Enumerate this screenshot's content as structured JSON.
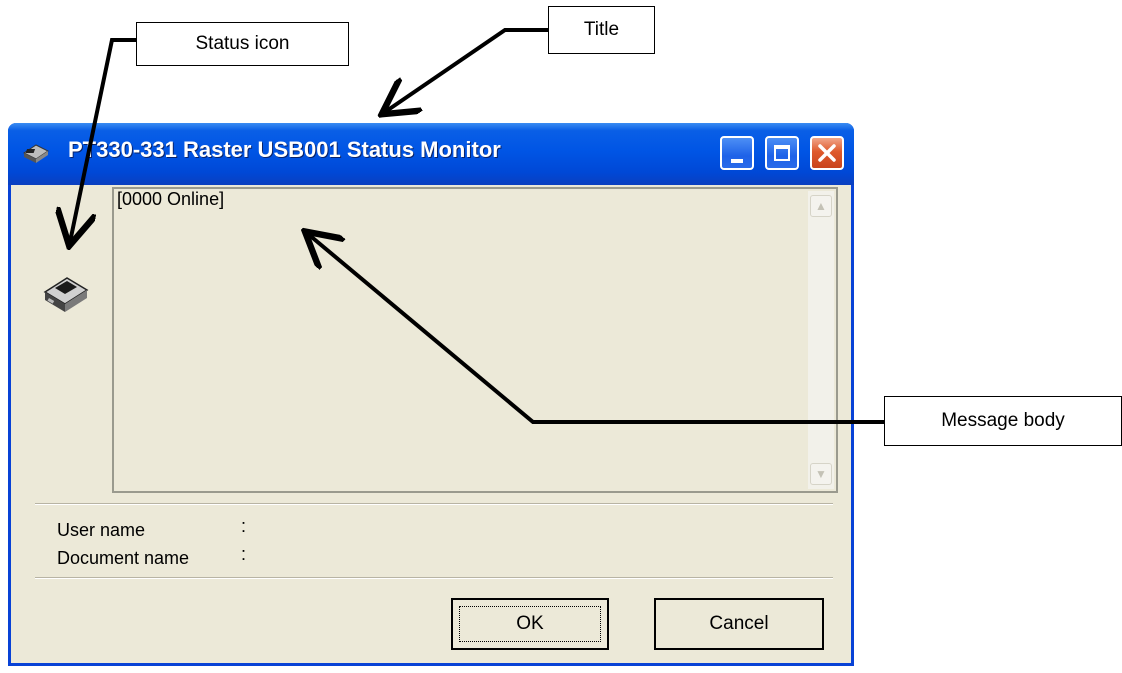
{
  "window": {
    "title": "PT330-331 Raster USB001 Status Monitor",
    "message": "[0000 Online]",
    "user_name_label": "User name",
    "document_name_label": "Document name",
    "colon": ":",
    "ok_label": "OK",
    "cancel_label": "Cancel"
  },
  "callouts": {
    "status_icon": "Status icon",
    "title": "Title",
    "message_body": "Message body"
  },
  "colors": {
    "titlebar": "#0055e5",
    "window_bg": "#ece9d8",
    "close_button": "#df5a2c"
  },
  "icons": {
    "title_icon": "printer-icon",
    "status_icon": "printer-icon"
  }
}
